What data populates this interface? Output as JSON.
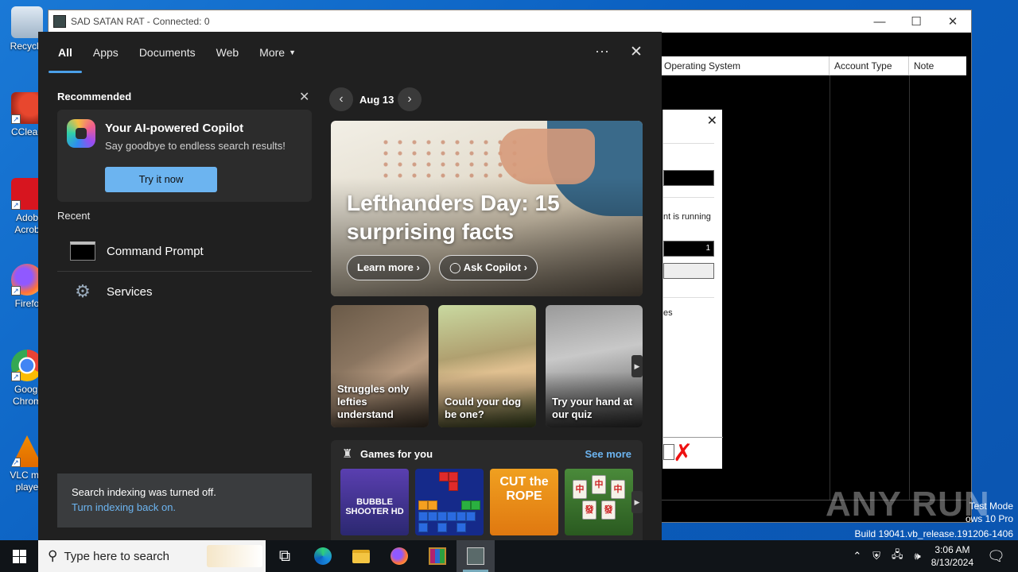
{
  "desktop": {
    "icons": [
      {
        "label": "Recycle"
      },
      {
        "label": "CClean"
      },
      {
        "label": "Adob Acrob"
      },
      {
        "label": "Firefo"
      },
      {
        "label": "Googl Chrom"
      },
      {
        "label": "VLC me playe"
      }
    ]
  },
  "rat_window": {
    "title": "SAD SATAN RAT - Connected: 0",
    "columns": [
      "Operating System",
      "Account Type",
      "Note"
    ],
    "dialog": {
      "text1": "nt is running",
      "text2": "1",
      "text3": "es"
    }
  },
  "search_panel": {
    "tabs": [
      "All",
      "Apps",
      "Documents",
      "Web",
      "More"
    ],
    "active_tab": "All",
    "more_options": "···",
    "recommended_title": "Recommended",
    "copilot": {
      "title": "Your AI-powered Copilot",
      "subtitle": "Say goodbye to endless search results!",
      "button": "Try it now"
    },
    "recent_title": "Recent",
    "recent": [
      "Command Prompt",
      "Services"
    ],
    "indexing": {
      "message": "Search indexing was turned off.",
      "link": "Turn indexing back on."
    },
    "date": "Aug 13",
    "hero": {
      "title": "Lefthanders Day: 15 surprising facts",
      "learn_more": "Learn more",
      "ask_copilot": "Ask Copilot"
    },
    "tiles": [
      {
        "caption": "Struggles only lefties understand"
      },
      {
        "caption": "Could your dog be one?"
      },
      {
        "caption": "Try your hand at our quiz"
      }
    ],
    "games": {
      "title": "Games for you",
      "see_more": "See more",
      "items": [
        "BUBBLE SHOOTER HD",
        "Tetris",
        "CUT the ROPE",
        "Mahjong"
      ]
    }
  },
  "watermark": {
    "logo": "ANY RUN",
    "line1": "Test Mode",
    "line2": "ows 10 Pro",
    "line3": "Build 19041.vb_release.191206-1406"
  },
  "taskbar": {
    "search_placeholder": "Type here to search",
    "time": "3:06 AM",
    "date": "8/13/2024"
  }
}
